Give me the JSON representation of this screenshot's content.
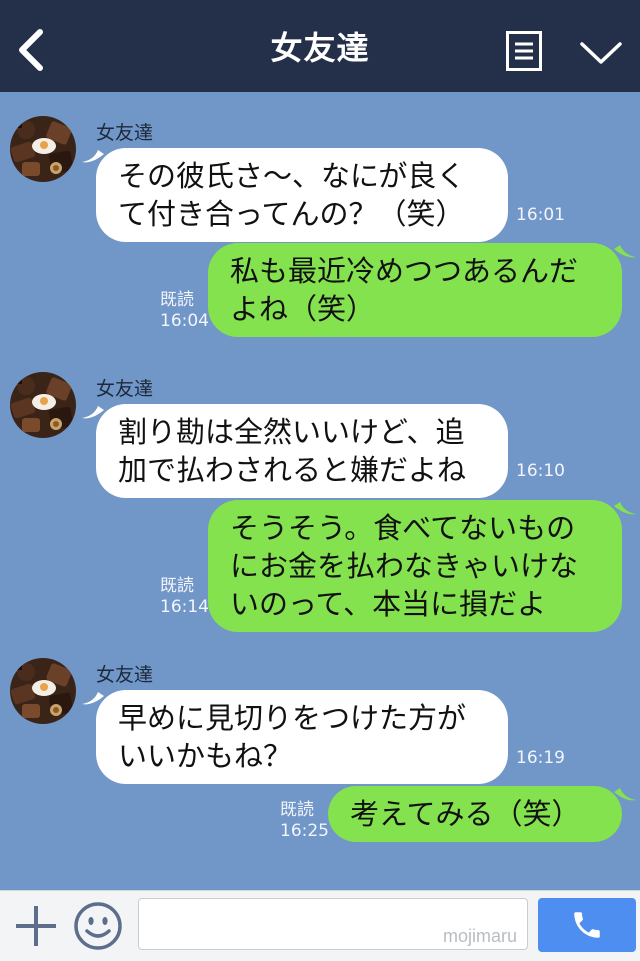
{
  "header": {
    "title": "女友達",
    "back_icon": "chevron-left-icon",
    "menu_icon": "menu-icon",
    "collapse_icon": "chevron-down-icon"
  },
  "messages": [
    {
      "direction": "in",
      "sender": "女友達",
      "lines": [
        "その彼氏さ〜、なにが良く",
        "て付き合ってんの？（笑）"
      ],
      "time": "16:01"
    },
    {
      "direction": "out",
      "read_label": "既読",
      "lines": [
        "私も最近冷めつつあるんだ",
        "よね（笑）"
      ],
      "time": "16:04"
    },
    {
      "direction": "in",
      "sender": "女友達",
      "lines": [
        "割り勘は全然いいけど、追",
        "加で払わされると嫌だよね"
      ],
      "time": "16:10"
    },
    {
      "direction": "out",
      "read_label": "既読",
      "lines": [
        "そうそう。食べてないもの",
        "にお金を払わなきゃいけな",
        "いのって、本当に損だよ"
      ],
      "time": "16:14"
    },
    {
      "direction": "in",
      "sender": "女友達",
      "lines": [
        "早めに見切りをつけた方が",
        "いいかもね？"
      ],
      "time": "16:19"
    },
    {
      "direction": "out",
      "read_label": "既読",
      "lines": [
        "考えてみる（笑）"
      ],
      "time": "16:25"
    }
  ],
  "footer": {
    "plus_icon": "plus-icon",
    "emoji_icon": "smiley-icon",
    "input_value": "",
    "watermark": "mojimaru",
    "call_icon": "phone-icon"
  },
  "colors": {
    "header_bg": "#24304a",
    "chat_bg": "#7196c8",
    "incoming_bubble": "#ffffff",
    "outgoing_bubble": "#84e24e",
    "call_button": "#4d8ef0"
  }
}
